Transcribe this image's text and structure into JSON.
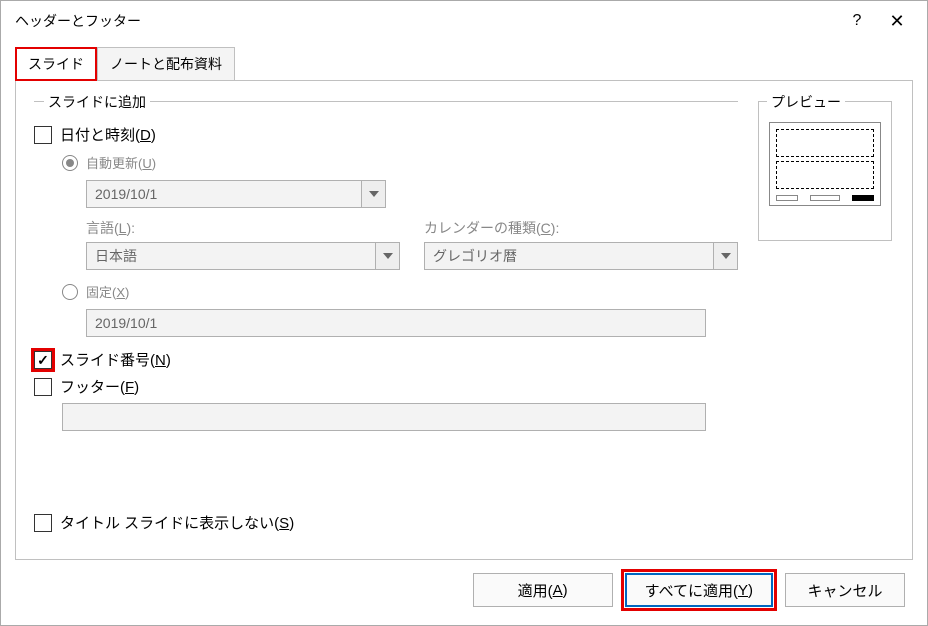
{
  "dialog": {
    "title": "ヘッダーとフッター"
  },
  "tabs": {
    "slide": "スライド",
    "notes": "ノートと配布資料"
  },
  "fieldset": {
    "legend": "スライドに追加"
  },
  "datetime": {
    "label_pre": "日付と時刻(",
    "label_key": "D",
    "label_post": ")",
    "auto_pre": "自動更新(",
    "auto_key": "U",
    "auto_post": ")",
    "auto_value": "2019/10/1",
    "lang_label_pre": "言語(",
    "lang_label_key": "L",
    "lang_label_post": "):",
    "lang_value": "日本語",
    "caltype_label_pre": "カレンダーの種類(",
    "caltype_label_key": "C",
    "caltype_label_post": "):",
    "caltype_value": "グレゴリオ暦",
    "fixed_pre": "固定(",
    "fixed_key": "X",
    "fixed_post": ")",
    "fixed_value": "2019/10/1"
  },
  "slidenum": {
    "label_pre": "スライド番号(",
    "label_key": "N",
    "label_post": ")"
  },
  "footer": {
    "label_pre": "フッター(",
    "label_key": "F",
    "label_post": ")",
    "value": ""
  },
  "hideTitle": {
    "label_pre": "タイトル スライドに表示しない(",
    "label_key": "S",
    "label_post": ")"
  },
  "preview": {
    "legend": "プレビュー"
  },
  "buttons": {
    "apply_pre": "適用(",
    "apply_key": "A",
    "apply_post": ")",
    "applyall_pre": "すべてに適用(",
    "applyall_key": "Y",
    "applyall_post": ")",
    "cancel": "キャンセル"
  }
}
